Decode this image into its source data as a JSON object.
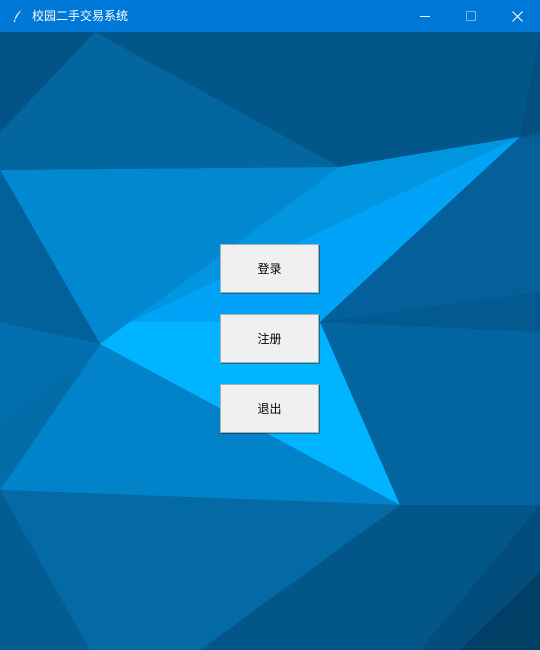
{
  "window": {
    "title": "校园二手交易系统",
    "app_icon": "feather-icon"
  },
  "controls": {
    "minimize_icon": "minimize-icon",
    "maximize_icon": "maximize-icon",
    "close_icon": "close-icon"
  },
  "menu": {
    "login_label": "登录",
    "register_label": "注册",
    "exit_label": "退出"
  },
  "colors": {
    "titlebar": "#0078d7",
    "background_dark": "#035a8f",
    "background_bright": "#00b4ff",
    "button_face": "#f0f0f0"
  }
}
